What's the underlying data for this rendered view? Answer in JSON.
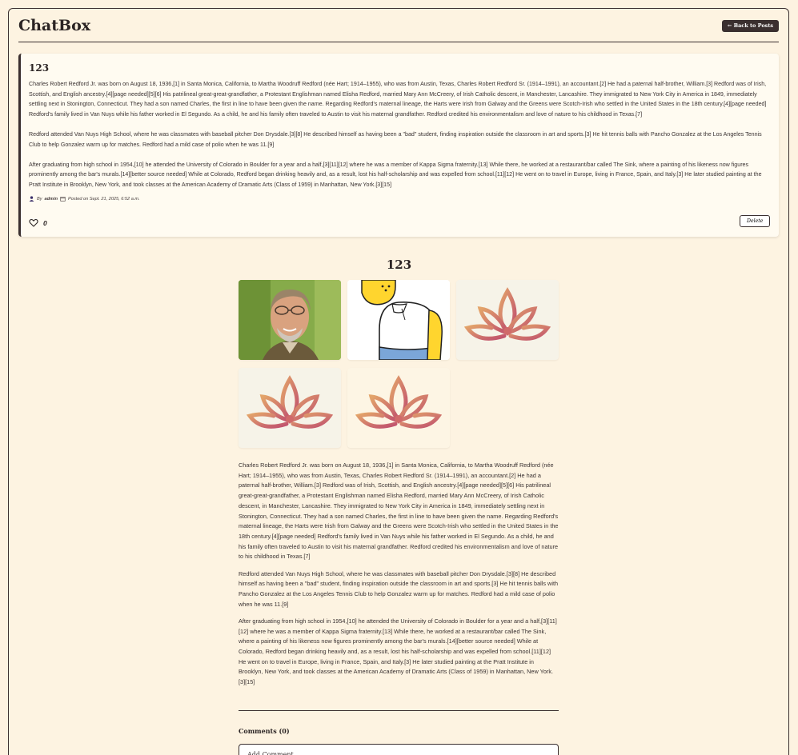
{
  "app": {
    "brand": "ChatBox",
    "back_label": "← Back to Posts"
  },
  "post": {
    "title": "123",
    "paragraphs": [
      "Charles Robert Redford Jr. was born on August 18, 1936,[1] in Santa Monica, California, to Martha Woodruff Redford (née Hart; 1914–1955), who was from Austin, Texas, Charles Robert Redford Sr. (1914–1991), an accountant.[2] He had a paternal half-brother, William.[3] Redford was of Irish, Scottish, and English ancestry.[4][page needed][5][6] His patrilineal great-great-grandfather, a Protestant Englishman named Elisha Redford, married Mary Ann McCreery, of Irish Catholic descent, in Manchester, Lancashire. They immigrated to New York City in America in 1849, immediately settling next in Stonington, Connecticut. They had a son named Charles, the first in line to have been given the name. Regarding Redford's maternal lineage, the Harts were Irish from Galway and the Greens were Scotch-Irish who settled in the United States in the 18th century.[4][page needed] Redford's family lived in Van Nuys while his father worked in El Segundo. As a child, he and his family often traveled to Austin to visit his maternal grandfather. Redford credited his environmentalism and love of nature to his childhood in Texas.[7]",
      "Redford attended Van Nuys High School, where he was classmates with baseball pitcher Don Drysdale.[3][8] He described himself as having been a \"bad\" student, finding inspiration outside the classroom in art and sports.[3] He hit tennis balls with Pancho Gonzalez at the Los Angeles Tennis Club to help Gonzalez warm up for matches. Redford had a mild case of polio when he was 11.[9]",
      "After graduating from high school in 1954,[10] he attended the University of Colorado in Boulder for a year and a half,[3][11][12] where he was a member of Kappa Sigma fraternity.[13] While there, he worked at a restaurant/bar called The Sink, where a painting of his likeness now figures prominently among the bar's murals.[14][better source needed] While at Colorado, Redford began drinking heavily and, as a result, lost his half-scholarship and was expelled from school.[11][12] He went on to travel in Europe, living in France, Spain, and Italy.[3] He later studied painting at the Pratt Institute in Brooklyn, New York, and took classes at the American Academy of Dramatic Arts (Class of 1959) in Manhattan, New York.[3][15]"
    ],
    "meta_by": "By",
    "meta_author": "admin",
    "meta_posted": "Posted on Sept. 21, 2025, 6:52 a.m.",
    "like_count": "0",
    "delete_label": "Delete"
  },
  "detail": {
    "title": "123",
    "images": [
      {
        "icon": "portrait-photo"
      },
      {
        "icon": "cartoon-character"
      },
      {
        "icon": "lotus-logo"
      },
      {
        "icon": "lotus-logo"
      },
      {
        "icon": "lotus-logo"
      }
    ]
  },
  "comments": {
    "heading": "Comments (0)",
    "input_text": "Add Comment"
  },
  "colors": {
    "background": "#fdf3e1",
    "dark": "#3a2f2f",
    "card": "#fffbf1",
    "lotus": "#c96a6a"
  }
}
